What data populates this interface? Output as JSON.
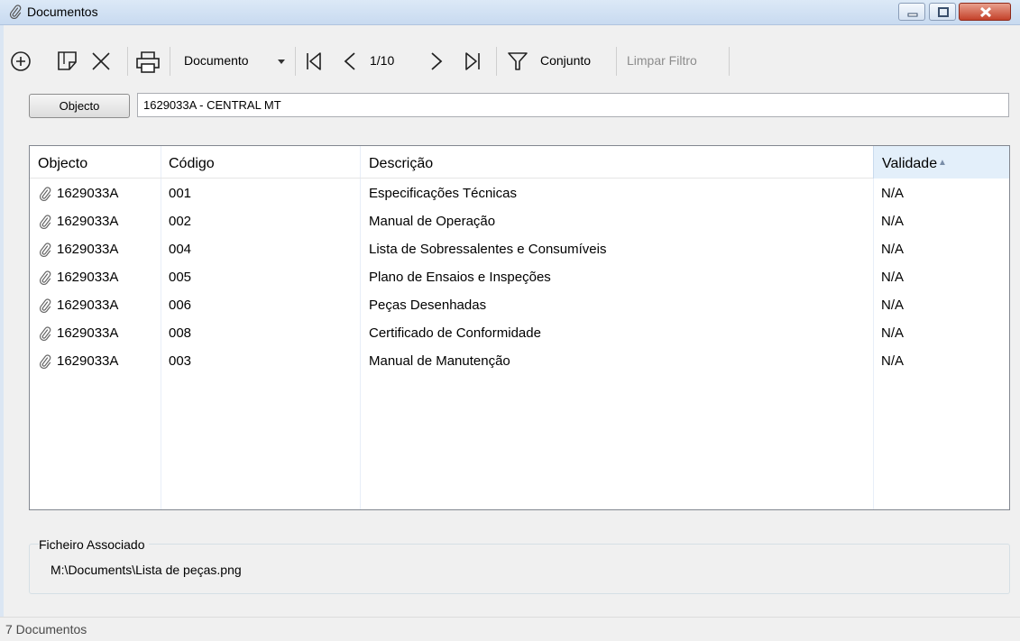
{
  "window": {
    "title": "Documentos",
    "icon": "paperclip-icon",
    "controls": [
      "minimize-icon",
      "maximize-icon",
      "close-icon"
    ]
  },
  "toolbar": {
    "icons": [
      "add-circle-icon",
      "open-document-icon",
      "delete-icon",
      "print-icon",
      "first-record-icon",
      "previous-icon",
      "next-icon",
      "last-record-icon",
      "filter-icon"
    ],
    "document_label": "Documento",
    "page_indicator": "1/10",
    "set_label": "Conjunto",
    "clear_filter_label": "Limpar Filtro"
  },
  "object": {
    "button_label": "Objecto",
    "value": "1629033A - CENTRAL MT"
  },
  "table": {
    "columns": [
      "Objecto",
      "Código",
      "Descrição",
      "Validade"
    ],
    "sort_column": "Validade",
    "rows": [
      {
        "objecto": "1629033A",
        "codigo": "001",
        "descricao": "Especificações Técnicas",
        "validade": "N/A"
      },
      {
        "objecto": "1629033A",
        "codigo": "002",
        "descricao": "Manual de Operação",
        "validade": "N/A"
      },
      {
        "objecto": "1629033A",
        "codigo": "004",
        "descricao": "Lista de Sobressalentes e Consumíveis",
        "validade": "N/A"
      },
      {
        "objecto": "1629033A",
        "codigo": "005",
        "descricao": "Plano de Ensaios e Inspeções",
        "validade": "N/A"
      },
      {
        "objecto": "1629033A",
        "codigo": "006",
        "descricao": "Peças Desenhadas",
        "validade": "N/A"
      },
      {
        "objecto": "1629033A",
        "codigo": "008",
        "descricao": "Certificado de Conformidade",
        "validade": "N/A"
      },
      {
        "objecto": "1629033A",
        "codigo": "003",
        "descricao": "Manual de Manutenção",
        "validade": "N/A"
      }
    ]
  },
  "associated_file": {
    "label": "Ficheiro Associado",
    "path": "M:\\Documents\\Lista de peças.png"
  },
  "status": {
    "text": "7 Documentos"
  },
  "colors": {
    "titlebar": "#c8daf0",
    "close_button": "#c4412a",
    "sorted_header": "#e3effa"
  }
}
